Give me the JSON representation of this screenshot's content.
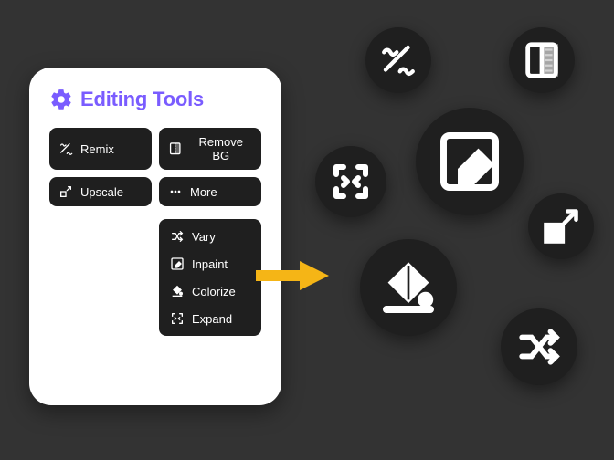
{
  "panel": {
    "title": "Editing Tools",
    "tools": {
      "remix": "Remix",
      "removebg": "Remove BG",
      "upscale": "Upscale",
      "more": "More"
    },
    "more_menu": {
      "vary": "Vary",
      "inpaint": "Inpaint",
      "colorize": "Colorize",
      "expand": "Expand"
    }
  },
  "colors": {
    "accent": "#7a5cff",
    "arrow": "#f5b516",
    "bubble_bg": "#1f1f1f"
  }
}
